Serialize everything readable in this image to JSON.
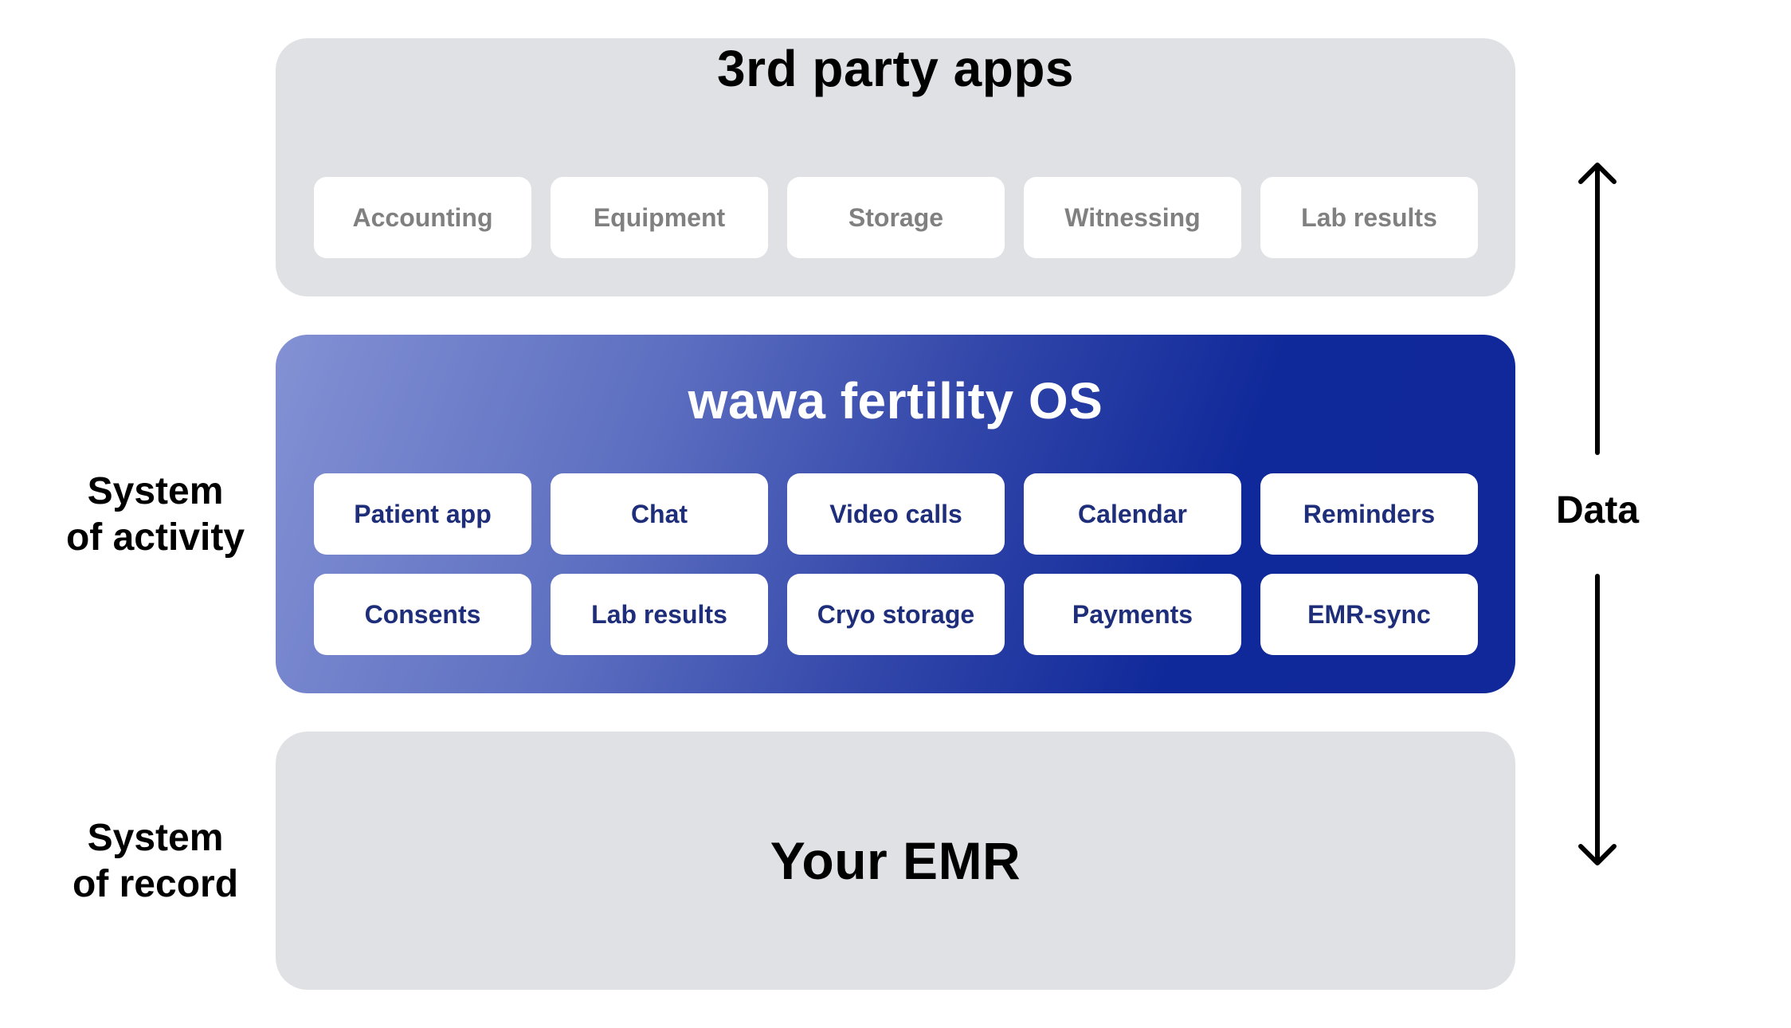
{
  "layers": {
    "third_party": {
      "title": "3rd party apps",
      "items": [
        "Accounting",
        "Equipment",
        "Storage",
        "Witnessing",
        "Lab results"
      ]
    },
    "os": {
      "title": "wawa fertility OS",
      "rows": [
        [
          "Patient app",
          "Chat",
          "Video calls",
          "Calendar",
          "Reminders"
        ],
        [
          "Consents",
          "Lab results",
          "Cryo storage",
          "Payments",
          "EMR-sync"
        ]
      ]
    },
    "emr": {
      "title": "Your EMR"
    }
  },
  "side_labels": {
    "activity": [
      "System",
      "of activity"
    ],
    "record": [
      "System",
      "of record"
    ]
  },
  "data_flow": {
    "label": "Data",
    "arrows": [
      "arrow-up-icon",
      "arrow-down-icon"
    ]
  },
  "colors": {
    "panel_gray": "#e0e1e5",
    "os_gradient_start": "#8391d4",
    "os_gradient_end": "#10289a",
    "card_text_gray": "#808080",
    "card_text_blue": "#1f2e7a"
  }
}
